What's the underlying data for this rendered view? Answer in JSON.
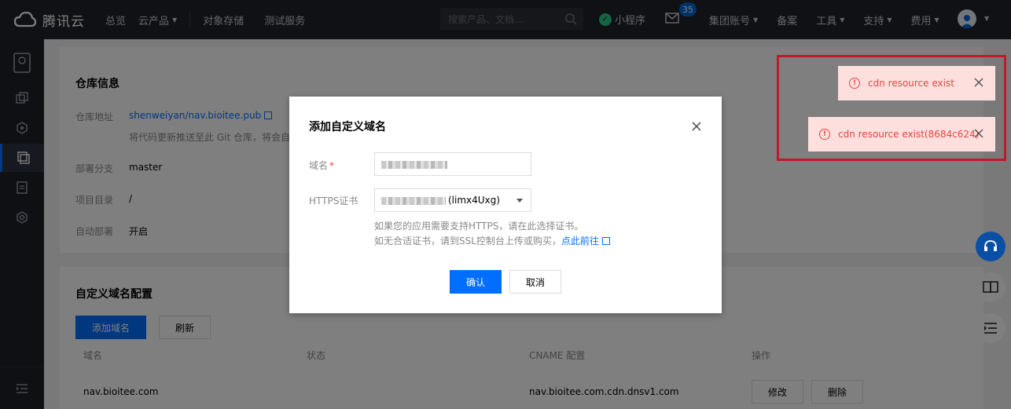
{
  "topnav": {
    "brand": "腾讯云",
    "items": [
      {
        "label": "总览",
        "caret": false
      },
      {
        "label": "云产品",
        "caret": true
      },
      {
        "label": "对象存储",
        "caret": false
      },
      {
        "label": "测试服务",
        "caret": false
      }
    ],
    "search_placeholder": "搜索产品、文档...",
    "mini_program": "小程序",
    "mail_badge": "35",
    "right_items": [
      {
        "label": "集团账号",
        "caret": true
      },
      {
        "label": "备案",
        "caret": false
      },
      {
        "label": "工具",
        "caret": true
      },
      {
        "label": "支持",
        "caret": true
      },
      {
        "label": "费用",
        "caret": true
      }
    ]
  },
  "repo": {
    "title": "仓库信息",
    "address_label": "仓库地址",
    "address_value": "shenweiyan/nav.bioitee.pub",
    "address_hint": "将代码更新推送至此 Git 仓库，将会自",
    "branch_label": "部署分支",
    "branch_value": "master",
    "dir_label": "项目目录",
    "dir_value": "/",
    "auto_label": "自动部署",
    "auto_value": "开启"
  },
  "domain_cfg": {
    "title": "自定义域名配置",
    "add_button": "添加域名",
    "refresh_button": "刷新",
    "columns": [
      "域名",
      "状态",
      "CNAME 配置",
      "操作"
    ],
    "rows": [
      {
        "domain": "nav.bioitee.com",
        "status": "",
        "cname": "nav.bioitee.com.cdn.dnsv1.com",
        "edit": "修改",
        "delete": "删除"
      }
    ]
  },
  "dialog": {
    "title": "添加自定义域名",
    "domain_label": "域名",
    "required_mark": "*",
    "https_label": "HTTPS证书",
    "cert_value_suffix": "(limx4Uxg)",
    "hint_line1": "如果您的应用需要支持HTTPS，请在此选择证书。",
    "hint_line2": "如无合适证书，请到SSL控制台上传或购买，",
    "hint_link": "点此前往",
    "confirm": "确认",
    "cancel": "取消"
  },
  "toasts": [
    {
      "message": "cdn resource exist"
    },
    {
      "message": "cdn resource exist(8684c624)"
    }
  ],
  "colors": {
    "primary": "#006eff",
    "error": "#e54545",
    "toast_bg": "#fde0dd",
    "highlight_border": "#c0192a",
    "nav_bg": "#1f2228"
  }
}
